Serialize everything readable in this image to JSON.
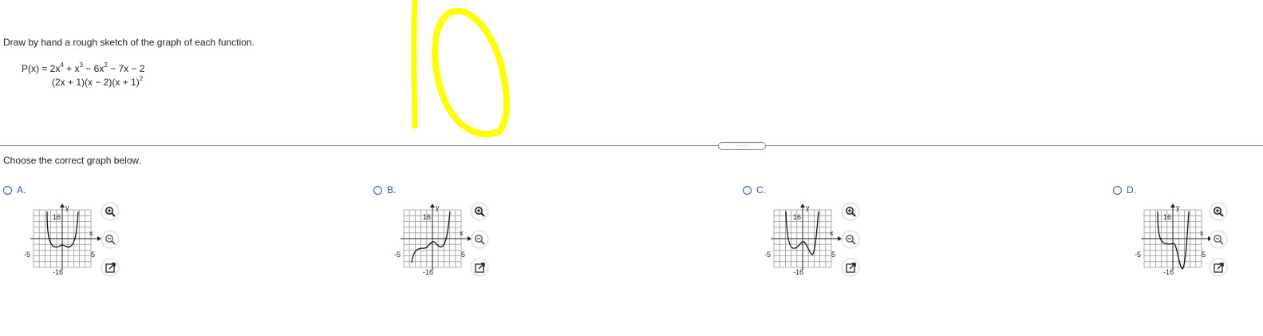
{
  "question": {
    "instruction": "Draw by hand a rough sketch of the graph of each function.",
    "equation_line1_prefix": "P(x) = 2x",
    "eq_sup1": "4",
    "eq_mid1": " + x",
    "eq_sup2": "3",
    "eq_mid2": " − 6x",
    "eq_sup3": "2",
    "eq_end1": " − 7x − 2",
    "equation_line2": "(2x + 1)(x − 2)(x + 1)",
    "eq_sup4": "2"
  },
  "divider_handle": ".....",
  "prompt": "Choose the correct graph below.",
  "options": [
    {
      "label": "A.",
      "ticks": {
        "y_max": "16",
        "y_min": "-16",
        "x_min": "-5",
        "x_max": "5",
        "x_axis": "x",
        "y_axis": "y"
      }
    },
    {
      "label": "B.",
      "ticks": {
        "y_max": "16",
        "y_min": "-16",
        "x_min": "-5",
        "x_max": "5",
        "x_axis": "x",
        "y_axis": "y"
      }
    },
    {
      "label": "C.",
      "ticks": {
        "y_max": "16",
        "y_min": "-16",
        "x_min": "-5",
        "x_max": "5",
        "x_axis": "x",
        "y_axis": "y"
      }
    },
    {
      "label": "D.",
      "ticks": {
        "y_max": "16",
        "y_min": "-16",
        "x_min": "-5",
        "x_max": "5",
        "x_axis": "x",
        "y_axis": "y"
      }
    }
  ],
  "icons": [
    "zoom-in-icon",
    "zoom-out-icon",
    "popout-icon"
  ],
  "colors": {
    "accent": "#2d5aa0",
    "annotation": "#ffff00",
    "divider": "#7b8a99"
  }
}
